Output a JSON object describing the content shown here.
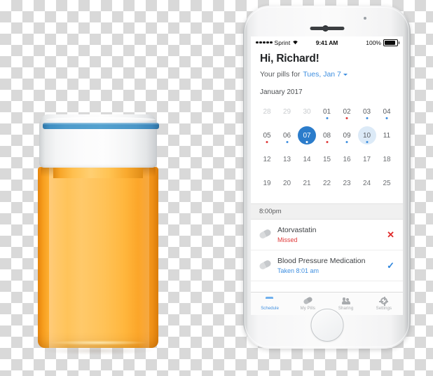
{
  "scene": {
    "product_image": "pill-bottle-orange-with-white-blue-cap",
    "device": "white-silver-smartphone"
  },
  "status_bar": {
    "carrier": "Sprint",
    "time": "9:41 AM",
    "battery_percent": "100%",
    "signal_icon": "signal-dots-icon",
    "wifi_icon": "wifi-icon",
    "battery_icon": "battery-full-icon"
  },
  "header": {
    "greeting": "Hi, Richard!",
    "pills_for_label": "Your pills for",
    "selected_date": "Tues, Jan 7",
    "chevron_icon": "chevron-down-icon"
  },
  "calendar": {
    "month_label": "January 2017",
    "rows": [
      [
        {
          "day": "28",
          "style": "muted",
          "dot": null
        },
        {
          "day": "29",
          "style": "muted",
          "dot": null
        },
        {
          "day": "30",
          "style": "muted",
          "dot": null
        },
        {
          "day": "01",
          "style": "strong",
          "dot": "blue"
        },
        {
          "day": "02",
          "style": "strong",
          "dot": "red"
        },
        {
          "day": "03",
          "style": "strong",
          "dot": "blue"
        },
        {
          "day": "04",
          "style": "strong",
          "dot": "blue"
        }
      ],
      [
        {
          "day": "05",
          "style": "strong",
          "dot": "red"
        },
        {
          "day": "06",
          "style": "strong",
          "dot": "blue"
        },
        {
          "day": "07",
          "style": "selected",
          "dot": "white"
        },
        {
          "day": "08",
          "style": "strong",
          "dot": "red"
        },
        {
          "day": "09",
          "style": "strong",
          "dot": "blue"
        },
        {
          "day": "10",
          "style": "highlight",
          "dot": "blue"
        },
        {
          "day": "11",
          "style": "strong",
          "dot": null
        }
      ],
      [
        {
          "day": "12",
          "style": "",
          "dot": null
        },
        {
          "day": "13",
          "style": "",
          "dot": null
        },
        {
          "day": "14",
          "style": "",
          "dot": null
        },
        {
          "day": "15",
          "style": "",
          "dot": null
        },
        {
          "day": "16",
          "style": "",
          "dot": null
        },
        {
          "day": "17",
          "style": "",
          "dot": null
        },
        {
          "day": "18",
          "style": "",
          "dot": null
        }
      ],
      [
        {
          "day": "19",
          "style": "",
          "dot": null
        },
        {
          "day": "20",
          "style": "",
          "dot": null
        },
        {
          "day": "21",
          "style": "",
          "dot": null
        },
        {
          "day": "22",
          "style": "",
          "dot": null
        },
        {
          "day": "23",
          "style": "",
          "dot": null
        },
        {
          "day": "24",
          "style": "",
          "dot": null
        },
        {
          "day": "25",
          "style": "",
          "dot": null
        }
      ]
    ]
  },
  "schedule": {
    "time_header": "8:00pm",
    "medications": [
      {
        "name": "Atorvastatin",
        "status": "Missed",
        "status_type": "missed",
        "mark": "✕",
        "mark_type": "x",
        "icon": "pill-capsule-icon"
      },
      {
        "name": "Blood Pressure Medication",
        "status": "Taken 8:01 am",
        "status_type": "taken",
        "mark": "✓",
        "mark_type": "check",
        "icon": "pill-capsule-icon"
      }
    ]
  },
  "tab_bar": {
    "tabs": [
      {
        "label": "Schedule",
        "icon": "calendar-check-icon",
        "active": true
      },
      {
        "label": "My Pills",
        "icon": "pill-icon",
        "active": false
      },
      {
        "label": "Sharing",
        "icon": "people-icon",
        "active": false
      },
      {
        "label": "Settings",
        "icon": "gear-icon",
        "active": false
      }
    ]
  },
  "colors": {
    "accent_blue": "#3f8fe0",
    "selected_blue": "#2b7ccb",
    "highlight_blue": "#dceaf7",
    "missed_red": "#e03b3b",
    "bottle_orange": "#ffc056",
    "cap_stripe_blue": "#4e9bcb"
  }
}
